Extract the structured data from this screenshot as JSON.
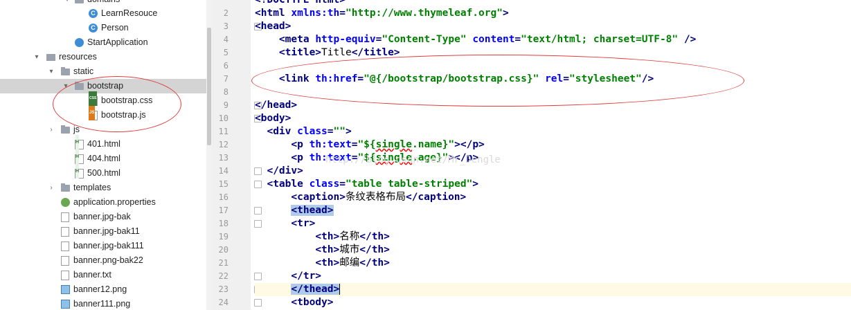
{
  "project_tree": {
    "items": [
      {
        "label": "domains",
        "icon": "folder-icon",
        "expanded": true
      },
      {
        "label": "LearnResouce",
        "icon": "class-icon"
      },
      {
        "label": "Person",
        "icon": "class-icon"
      },
      {
        "label": "StartApplication",
        "icon": "spring-app-icon"
      },
      {
        "label": "resources",
        "icon": "resources-folder-icon",
        "expanded": true
      },
      {
        "label": "static",
        "icon": "folder-icon",
        "expanded": true
      },
      {
        "label": "bootstrap",
        "icon": "folder-icon",
        "expanded": true,
        "selected": true
      },
      {
        "label": "bootstrap.css",
        "icon": "css-file-icon"
      },
      {
        "label": "bootstrap.js",
        "icon": "js-file-icon"
      },
      {
        "label": "js",
        "icon": "folder-icon",
        "expanded": false
      },
      {
        "label": "401.html",
        "icon": "html-file-icon"
      },
      {
        "label": "404.html",
        "icon": "html-file-icon"
      },
      {
        "label": "500.html",
        "icon": "html-file-icon"
      },
      {
        "label": "templates",
        "icon": "folder-icon",
        "expanded": false
      },
      {
        "label": "application.properties",
        "icon": "properties-file-icon"
      },
      {
        "label": "banner.jpg-bak",
        "icon": "text-file-icon"
      },
      {
        "label": "banner.jpg-bak11",
        "icon": "text-file-icon"
      },
      {
        "label": "banner.jpg-bak111",
        "icon": "text-file-icon"
      },
      {
        "label": "banner.png-bak22",
        "icon": "text-file-icon"
      },
      {
        "label": "banner.txt",
        "icon": "text-file-icon"
      },
      {
        "label": "banner12.png",
        "icon": "image-file-icon"
      },
      {
        "label": "banner111.png",
        "icon": "image-file-icon"
      }
    ],
    "class_badge": "C"
  },
  "editor": {
    "line_numbers": [
      "2",
      "3",
      "4",
      "5",
      "6",
      "7",
      "8",
      "9",
      "10",
      "11",
      "12",
      "13",
      "14",
      "15",
      "16",
      "17",
      "18",
      "19",
      "20",
      "21",
      "22",
      "23",
      "24"
    ],
    "lines": [
      {
        "indent": "",
        "parts": [
          {
            "t": "tag",
            "s": "<html "
          },
          {
            "t": "attr",
            "s": "xmlns:th"
          },
          {
            "t": "tag",
            "s": "="
          },
          {
            "t": "val",
            "s": "\"http://www.thymeleaf.org\""
          },
          {
            "t": "tag",
            "s": ">"
          }
        ]
      },
      {
        "indent": "",
        "parts": [
          {
            "t": "tag",
            "s": "<head>"
          }
        ]
      },
      {
        "indent": "    ",
        "parts": [
          {
            "t": "tag",
            "s": "<meta "
          },
          {
            "t": "attr",
            "s": "http-equiv"
          },
          {
            "t": "tag",
            "s": "="
          },
          {
            "t": "val",
            "s": "\"Content-Type\" "
          },
          {
            "t": "attr",
            "s": "content"
          },
          {
            "t": "tag",
            "s": "="
          },
          {
            "t": "val",
            "s": "\"text/html; charset=UTF-8\" "
          },
          {
            "t": "tag",
            "s": "/>"
          }
        ]
      },
      {
        "indent": "    ",
        "parts": [
          {
            "t": "tag",
            "s": "<title>"
          },
          {
            "t": "tx",
            "s": "Title"
          },
          {
            "t": "tag",
            "s": "</title>"
          }
        ]
      },
      {
        "indent": "",
        "parts": []
      },
      {
        "indent": "    ",
        "parts": [
          {
            "t": "tag",
            "s": "<link "
          },
          {
            "t": "attr",
            "s": "th:href"
          },
          {
            "t": "tag",
            "s": "="
          },
          {
            "t": "val",
            "s": "\"@{/bootstrap/bootstrap.css}\" "
          },
          {
            "t": "attr",
            "s": "rel"
          },
          {
            "t": "tag",
            "s": "="
          },
          {
            "t": "val",
            "s": "\"stylesheet\""
          },
          {
            "t": "tag",
            "s": "/>"
          }
        ]
      },
      {
        "indent": "",
        "parts": []
      },
      {
        "indent": "",
        "parts": [
          {
            "t": "tag",
            "s": "</head>"
          }
        ]
      },
      {
        "indent": "",
        "parts": [
          {
            "t": "tag",
            "s": "<body>"
          }
        ]
      },
      {
        "indent": "  ",
        "parts": [
          {
            "t": "tag",
            "s": "<div "
          },
          {
            "t": "attr",
            "s": "class"
          },
          {
            "t": "tag",
            "s": "="
          },
          {
            "t": "val",
            "s": "\"\""
          },
          {
            "t": "tag",
            "s": ">"
          }
        ]
      },
      {
        "indent": "      ",
        "parts": [
          {
            "t": "tag",
            "s": "<p "
          },
          {
            "t": "attr",
            "s": "th:text"
          },
          {
            "t": "tag",
            "s": "="
          },
          {
            "t": "val",
            "s": "\"${"
          },
          {
            "t": "valsq",
            "s": "single"
          },
          {
            "t": "val",
            "s": ".name}\""
          },
          {
            "t": "tag",
            "s": "></p>"
          }
        ]
      },
      {
        "indent": "      ",
        "parts": [
          {
            "t": "tag",
            "s": "<p "
          },
          {
            "t": "attr",
            "s": "th:text"
          },
          {
            "t": "tag",
            "s": "="
          },
          {
            "t": "val",
            "s": "\"${"
          },
          {
            "t": "valsq",
            "s": "single"
          },
          {
            "t": "val",
            "s": ".age}\""
          },
          {
            "t": "tag",
            "s": "></p>"
          }
        ]
      },
      {
        "indent": "  ",
        "parts": [
          {
            "t": "tag",
            "s": "</div>"
          }
        ]
      },
      {
        "indent": "  ",
        "parts": [
          {
            "t": "tag",
            "s": "<table "
          },
          {
            "t": "attr",
            "s": "class"
          },
          {
            "t": "tag",
            "s": "="
          },
          {
            "t": "val",
            "s": "\"table table-striped\""
          },
          {
            "t": "tag",
            "s": ">"
          }
        ]
      },
      {
        "indent": "      ",
        "parts": [
          {
            "t": "tag",
            "s": "<caption>"
          },
          {
            "t": "tx",
            "s": "条纹表格布局"
          },
          {
            "t": "tag",
            "s": "</caption>"
          }
        ]
      },
      {
        "indent": "      ",
        "parts": [
          {
            "t": "taghl",
            "s": "<thead>"
          }
        ]
      },
      {
        "indent": "      ",
        "parts": [
          {
            "t": "tag",
            "s": "<tr>"
          }
        ]
      },
      {
        "indent": "          ",
        "parts": [
          {
            "t": "tag",
            "s": "<th>"
          },
          {
            "t": "tx",
            "s": "名称"
          },
          {
            "t": "tag",
            "s": "</th>"
          }
        ]
      },
      {
        "indent": "          ",
        "parts": [
          {
            "t": "tag",
            "s": "<th>"
          },
          {
            "t": "tx",
            "s": "城市"
          },
          {
            "t": "tag",
            "s": "</th>"
          }
        ]
      },
      {
        "indent": "          ",
        "parts": [
          {
            "t": "tag",
            "s": "<th>"
          },
          {
            "t": "tx",
            "s": "邮编"
          },
          {
            "t": "tag",
            "s": "</th>"
          }
        ]
      },
      {
        "indent": "      ",
        "parts": [
          {
            "t": "tag",
            "s": "</tr>"
          }
        ]
      },
      {
        "indent": "      ",
        "parts": [
          {
            "t": "taghl",
            "s": "</thead>"
          },
          {
            "t": "cursor",
            "s": ""
          }
        ],
        "caret": true
      },
      {
        "indent": "      ",
        "parts": [
          {
            "t": "tag",
            "s": "<tbody>"
          }
        ]
      }
    ],
    "partial_top_line": "<!DOCTYPE html>",
    "watermark": "http://blog.csdn.net/Mr_Dengle"
  }
}
